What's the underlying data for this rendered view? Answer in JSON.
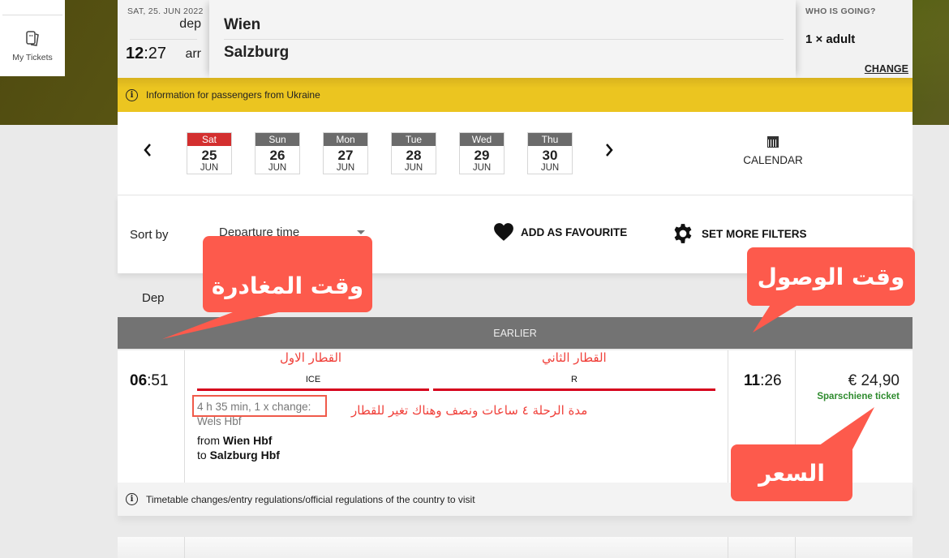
{
  "sidebar": {
    "my_tickets_label": "My Tickets"
  },
  "search": {
    "date": "SAT, 25. JUN 2022",
    "dep_label": "dep",
    "time_hours": "12",
    "time_minutes": ":27",
    "arr_label": "arr",
    "from": "Wien",
    "to": "Salzburg",
    "who_label": "WHO IS GOING?",
    "who_value": "1 × adult",
    "change_label": "CHANGE"
  },
  "info_banner": {
    "text": "Information for passengers from Ukraine"
  },
  "date_selector": {
    "days": [
      {
        "dow": "Sat",
        "day": "25",
        "month": "JUN",
        "selected": true
      },
      {
        "dow": "Sun",
        "day": "26",
        "month": "JUN"
      },
      {
        "dow": "Mon",
        "day": "27",
        "month": "JUN"
      },
      {
        "dow": "Tue",
        "day": "28",
        "month": "JUN"
      },
      {
        "dow": "Wed",
        "day": "29",
        "month": "JUN"
      },
      {
        "dow": "Thu",
        "day": "30",
        "month": "JUN"
      }
    ],
    "prev_icon": "‹",
    "next_icon": "›",
    "calendar_label": "CALENDAR"
  },
  "sort": {
    "label": "Sort by",
    "selected": "Departure time",
    "favourite_label": "ADD AS FAVOURITE",
    "filters_label": "SET MORE FILTERS"
  },
  "results": {
    "dep_header": "Dep",
    "earlier_label": "EARLIER",
    "connections": [
      {
        "dep_hours": "06",
        "dep_minutes": ":51",
        "arr_hours": "11",
        "arr_minutes": ":26",
        "segments": [
          {
            "name": "ICE"
          },
          {
            "name": "R"
          }
        ],
        "duration": "4 h 35 min, 1 x change:",
        "change_station": "Wels Hbf",
        "from_prefix": "from ",
        "from_station": "Wien Hbf",
        "to_prefix": "to ",
        "to_station": "Salzburg Hbf",
        "price": "€ 24,90",
        "fare": "Sparschiene ticket"
      }
    ],
    "notice": "Timetable changes/entry regulations/official regulations of the country to visit"
  },
  "annotations": {
    "departure_time": "وقت المغادرة",
    "arrival_time": "وقت الوصول",
    "first_train": "القطار الاول",
    "second_train": "القطار الثاني",
    "duration_note": "مدة الرحلة ٤ ساعات ونصف وهناك تغير للقطار",
    "price": "السعر",
    "color": "#fd5a4c"
  }
}
